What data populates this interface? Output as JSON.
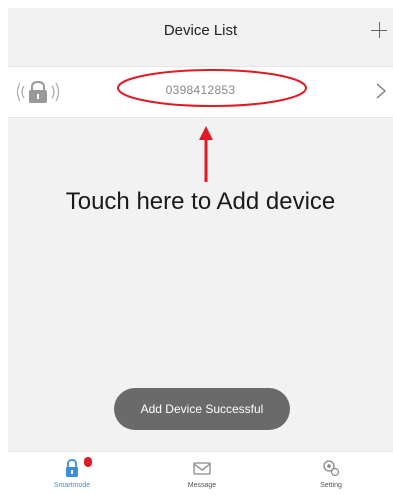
{
  "header": {
    "title": "Device List",
    "add_icon": "plus-icon"
  },
  "device": {
    "number": "0398412853",
    "icon": "lock-signal-icon",
    "chevron_icon": "chevron-right-icon"
  },
  "instruction": {
    "text": "Touch here to Add device"
  },
  "toast": {
    "text": "Add Device Successful"
  },
  "tabbar": {
    "tabs": [
      {
        "label": "Smartmode",
        "icon": "lock-icon",
        "active": true,
        "badge": true
      },
      {
        "label": "Message",
        "icon": "mail-icon",
        "active": false
      },
      {
        "label": "Setting",
        "icon": "settings-icon",
        "active": false
      }
    ]
  },
  "colors": {
    "accent": "#3a8fd8",
    "annotation": "#e01b24",
    "toast_bg": "#6a6a6a",
    "background": "#f2f2f2"
  }
}
